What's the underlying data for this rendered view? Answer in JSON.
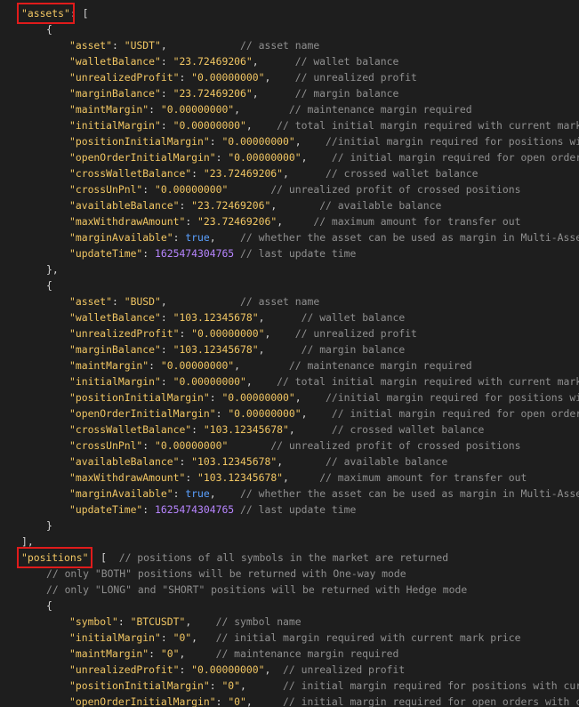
{
  "highlight_color": "#e01b1b",
  "lines": [
    [
      {
        "t": "k",
        "v": "\"assets\"",
        "box": true
      },
      {
        "t": "p",
        "v": ": ["
      }
    ],
    [
      {
        "t": "p",
        "v": "{"
      }
    ],
    [
      {
        "t": "k",
        "v": "\"asset\""
      },
      {
        "t": "p",
        "v": ": "
      },
      {
        "t": "s",
        "v": "\"USDT\""
      },
      {
        "t": "p",
        "v": ","
      },
      {
        "t": "c",
        "v": "            // asset name"
      }
    ],
    [
      {
        "t": "k",
        "v": "\"walletBalance\""
      },
      {
        "t": "p",
        "v": ": "
      },
      {
        "t": "s",
        "v": "\"23.72469206\""
      },
      {
        "t": "p",
        "v": ","
      },
      {
        "t": "c",
        "v": "      // wallet balance"
      }
    ],
    [
      {
        "t": "k",
        "v": "\"unrealizedProfit\""
      },
      {
        "t": "p",
        "v": ": "
      },
      {
        "t": "s",
        "v": "\"0.00000000\""
      },
      {
        "t": "p",
        "v": ","
      },
      {
        "t": "c",
        "v": "    // unrealized profit"
      }
    ],
    [
      {
        "t": "k",
        "v": "\"marginBalance\""
      },
      {
        "t": "p",
        "v": ": "
      },
      {
        "t": "s",
        "v": "\"23.72469206\""
      },
      {
        "t": "p",
        "v": ","
      },
      {
        "t": "c",
        "v": "      // margin balance"
      }
    ],
    [
      {
        "t": "k",
        "v": "\"maintMargin\""
      },
      {
        "t": "p",
        "v": ": "
      },
      {
        "t": "s",
        "v": "\"0.00000000\""
      },
      {
        "t": "p",
        "v": ","
      },
      {
        "t": "c",
        "v": "        // maintenance margin required"
      }
    ],
    [
      {
        "t": "k",
        "v": "\"initialMargin\""
      },
      {
        "t": "p",
        "v": ": "
      },
      {
        "t": "s",
        "v": "\"0.00000000\""
      },
      {
        "t": "p",
        "v": ","
      },
      {
        "t": "c",
        "v": "    // total initial margin required with current mark pri"
      }
    ],
    [
      {
        "t": "k",
        "v": "\"positionInitialMargin\""
      },
      {
        "t": "p",
        "v": ": "
      },
      {
        "t": "s",
        "v": "\"0.00000000\""
      },
      {
        "t": "p",
        "v": ","
      },
      {
        "t": "c",
        "v": "    //initial margin required for positions with c"
      }
    ],
    [
      {
        "t": "k",
        "v": "\"openOrderInitialMargin\""
      },
      {
        "t": "p",
        "v": ": "
      },
      {
        "t": "s",
        "v": "\"0.00000000\""
      },
      {
        "t": "p",
        "v": ","
      },
      {
        "t": "c",
        "v": "    // initial margin required for open orders wi"
      }
    ],
    [
      {
        "t": "k",
        "v": "\"crossWalletBalance\""
      },
      {
        "t": "p",
        "v": ": "
      },
      {
        "t": "s",
        "v": "\"23.72469206\""
      },
      {
        "t": "p",
        "v": ","
      },
      {
        "t": "c",
        "v": "      // crossed wallet balance"
      }
    ],
    [
      {
        "t": "k",
        "v": "\"crossUnPnl\""
      },
      {
        "t": "p",
        "v": ": "
      },
      {
        "t": "s",
        "v": "\"0.00000000\""
      },
      {
        "t": "c",
        "v": "       // unrealized profit of crossed positions"
      }
    ],
    [
      {
        "t": "k",
        "v": "\"availableBalance\""
      },
      {
        "t": "p",
        "v": ": "
      },
      {
        "t": "s",
        "v": "\"23.72469206\""
      },
      {
        "t": "p",
        "v": ","
      },
      {
        "t": "c",
        "v": "       // available balance"
      }
    ],
    [
      {
        "t": "k",
        "v": "\"maxWithdrawAmount\""
      },
      {
        "t": "p",
        "v": ": "
      },
      {
        "t": "s",
        "v": "\"23.72469206\""
      },
      {
        "t": "p",
        "v": ","
      },
      {
        "t": "c",
        "v": "     // maximum amount for transfer out"
      }
    ],
    [
      {
        "t": "k",
        "v": "\"marginAvailable\""
      },
      {
        "t": "p",
        "v": ": "
      },
      {
        "t": "b",
        "v": "true"
      },
      {
        "t": "p",
        "v": ","
      },
      {
        "t": "c",
        "v": "    // whether the asset can be used as margin in Multi-Assets m"
      }
    ],
    [
      {
        "t": "k",
        "v": "\"updateTime\""
      },
      {
        "t": "p",
        "v": ": "
      },
      {
        "t": "n",
        "v": "1625474304765"
      },
      {
        "t": "c",
        "v": " // last update time"
      }
    ],
    [
      {
        "t": "p",
        "v": "},"
      }
    ],
    [
      {
        "t": "p",
        "v": "{"
      }
    ],
    [
      {
        "t": "k",
        "v": "\"asset\""
      },
      {
        "t": "p",
        "v": ": "
      },
      {
        "t": "s",
        "v": "\"BUSD\""
      },
      {
        "t": "p",
        "v": ","
      },
      {
        "t": "c",
        "v": "            // asset name"
      }
    ],
    [
      {
        "t": "k",
        "v": "\"walletBalance\""
      },
      {
        "t": "p",
        "v": ": "
      },
      {
        "t": "s",
        "v": "\"103.12345678\""
      },
      {
        "t": "p",
        "v": ","
      },
      {
        "t": "c",
        "v": "      // wallet balance"
      }
    ],
    [
      {
        "t": "k",
        "v": "\"unrealizedProfit\""
      },
      {
        "t": "p",
        "v": ": "
      },
      {
        "t": "s",
        "v": "\"0.00000000\""
      },
      {
        "t": "p",
        "v": ","
      },
      {
        "t": "c",
        "v": "    // unrealized profit"
      }
    ],
    [
      {
        "t": "k",
        "v": "\"marginBalance\""
      },
      {
        "t": "p",
        "v": ": "
      },
      {
        "t": "s",
        "v": "\"103.12345678\""
      },
      {
        "t": "p",
        "v": ","
      },
      {
        "t": "c",
        "v": "      // margin balance"
      }
    ],
    [
      {
        "t": "k",
        "v": "\"maintMargin\""
      },
      {
        "t": "p",
        "v": ": "
      },
      {
        "t": "s",
        "v": "\"0.00000000\""
      },
      {
        "t": "p",
        "v": ","
      },
      {
        "t": "c",
        "v": "        // maintenance margin required"
      }
    ],
    [
      {
        "t": "k",
        "v": "\"initialMargin\""
      },
      {
        "t": "p",
        "v": ": "
      },
      {
        "t": "s",
        "v": "\"0.00000000\""
      },
      {
        "t": "p",
        "v": ","
      },
      {
        "t": "c",
        "v": "    // total initial margin required with current mark pri"
      }
    ],
    [
      {
        "t": "k",
        "v": "\"positionInitialMargin\""
      },
      {
        "t": "p",
        "v": ": "
      },
      {
        "t": "s",
        "v": "\"0.00000000\""
      },
      {
        "t": "p",
        "v": ","
      },
      {
        "t": "c",
        "v": "    //initial margin required for positions with c"
      }
    ],
    [
      {
        "t": "k",
        "v": "\"openOrderInitialMargin\""
      },
      {
        "t": "p",
        "v": ": "
      },
      {
        "t": "s",
        "v": "\"0.00000000\""
      },
      {
        "t": "p",
        "v": ","
      },
      {
        "t": "c",
        "v": "    // initial margin required for open orders wi"
      }
    ],
    [
      {
        "t": "k",
        "v": "\"crossWalletBalance\""
      },
      {
        "t": "p",
        "v": ": "
      },
      {
        "t": "s",
        "v": "\"103.12345678\""
      },
      {
        "t": "p",
        "v": ","
      },
      {
        "t": "c",
        "v": "      // crossed wallet balance"
      }
    ],
    [
      {
        "t": "k",
        "v": "\"crossUnPnl\""
      },
      {
        "t": "p",
        "v": ": "
      },
      {
        "t": "s",
        "v": "\"0.00000000\""
      },
      {
        "t": "c",
        "v": "       // unrealized profit of crossed positions"
      }
    ],
    [
      {
        "t": "k",
        "v": "\"availableBalance\""
      },
      {
        "t": "p",
        "v": ": "
      },
      {
        "t": "s",
        "v": "\"103.12345678\""
      },
      {
        "t": "p",
        "v": ","
      },
      {
        "t": "c",
        "v": "       // available balance"
      }
    ],
    [
      {
        "t": "k",
        "v": "\"maxWithdrawAmount\""
      },
      {
        "t": "p",
        "v": ": "
      },
      {
        "t": "s",
        "v": "\"103.12345678\""
      },
      {
        "t": "p",
        "v": ","
      },
      {
        "t": "c",
        "v": "     // maximum amount for transfer out"
      }
    ],
    [
      {
        "t": "k",
        "v": "\"marginAvailable\""
      },
      {
        "t": "p",
        "v": ": "
      },
      {
        "t": "b",
        "v": "true"
      },
      {
        "t": "p",
        "v": ","
      },
      {
        "t": "c",
        "v": "    // whether the asset can be used as margin in Multi-Assets m"
      }
    ],
    [
      {
        "t": "k",
        "v": "\"updateTime\""
      },
      {
        "t": "p",
        "v": ": "
      },
      {
        "t": "n",
        "v": "1625474304765"
      },
      {
        "t": "c",
        "v": " // last update time"
      }
    ],
    [
      {
        "t": "p",
        "v": "}"
      }
    ],
    [
      {
        "t": "p",
        "v": "],"
      }
    ],
    [
      {
        "t": "k",
        "v": "\"positions\"",
        "box": true
      },
      {
        "t": "p",
        "v": ": [  "
      },
      {
        "t": "c",
        "v": "// positions of all symbols in the market are returned"
      }
    ],
    [
      {
        "t": "c",
        "v": "// only \"BOTH\" positions will be returned with One-way mode"
      }
    ],
    [
      {
        "t": "c",
        "v": "// only \"LONG\" and \"SHORT\" positions will be returned with Hedge mode"
      }
    ],
    [
      {
        "t": "p",
        "v": "{"
      }
    ],
    [
      {
        "t": "k",
        "v": "\"symbol\""
      },
      {
        "t": "p",
        "v": ": "
      },
      {
        "t": "s",
        "v": "\"BTCUSDT\""
      },
      {
        "t": "p",
        "v": ","
      },
      {
        "t": "c",
        "v": "    // symbol name"
      }
    ],
    [
      {
        "t": "k",
        "v": "\"initialMargin\""
      },
      {
        "t": "p",
        "v": ": "
      },
      {
        "t": "s",
        "v": "\"0\""
      },
      {
        "t": "p",
        "v": ","
      },
      {
        "t": "c",
        "v": "   // initial margin required with current mark price"
      }
    ],
    [
      {
        "t": "k",
        "v": "\"maintMargin\""
      },
      {
        "t": "p",
        "v": ": "
      },
      {
        "t": "s",
        "v": "\"0\""
      },
      {
        "t": "p",
        "v": ","
      },
      {
        "t": "c",
        "v": "     // maintenance margin required"
      }
    ],
    [
      {
        "t": "k",
        "v": "\"unrealizedProfit\""
      },
      {
        "t": "p",
        "v": ": "
      },
      {
        "t": "s",
        "v": "\"0.00000000\""
      },
      {
        "t": "p",
        "v": ","
      },
      {
        "t": "c",
        "v": "  // unrealized profit"
      }
    ],
    [
      {
        "t": "k",
        "v": "\"positionInitialMargin\""
      },
      {
        "t": "p",
        "v": ": "
      },
      {
        "t": "s",
        "v": "\"0\""
      },
      {
        "t": "p",
        "v": ","
      },
      {
        "t": "c",
        "v": "      // initial margin required for positions with curren"
      }
    ],
    [
      {
        "t": "k",
        "v": "\"openOrderInitialMargin\""
      },
      {
        "t": "p",
        "v": ": "
      },
      {
        "t": "s",
        "v": "\"0\""
      },
      {
        "t": "p",
        "v": ","
      },
      {
        "t": "c",
        "v": "     // initial margin required for open orders with curr"
      }
    ]
  ]
}
